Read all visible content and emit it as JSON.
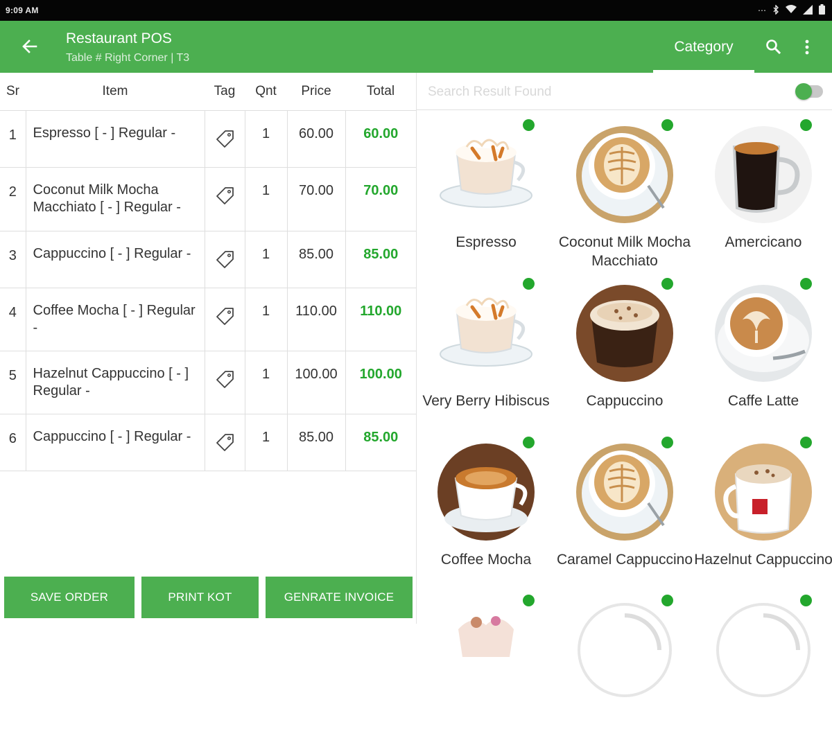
{
  "status": {
    "time": "9:09 AM"
  },
  "appbar": {
    "title": "Restaurant POS",
    "subtitle": "Table # Right Corner | T3",
    "tab_label": "Category"
  },
  "order": {
    "headers": {
      "sr": "Sr",
      "item": "Item",
      "tag": "Tag",
      "qnt": "Qnt",
      "price": "Price",
      "total": "Total"
    },
    "rows": [
      {
        "sr": "1",
        "item": "Espresso [ - ] Regular -",
        "qnt": "1",
        "price": "60.00",
        "total": "60.00"
      },
      {
        "sr": "2",
        "item": "Coconut Milk Mocha Macchiato [ - ] Regular -",
        "qnt": "1",
        "price": "70.00",
        "total": "70.00"
      },
      {
        "sr": "3",
        "item": "Cappuccino [ - ] Regular -",
        "qnt": "1",
        "price": "85.00",
        "total": "85.00"
      },
      {
        "sr": "4",
        "item": "Coffee Mocha [ - ] Regular -",
        "qnt": "1",
        "price": "110.00",
        "total": "110.00"
      },
      {
        "sr": "5",
        "item": "Hazelnut Cappuccino [ - ] Regular -",
        "qnt": "1",
        "price": "100.00",
        "total": "100.00"
      },
      {
        "sr": "6",
        "item": "Cappuccino [ - ] Regular -",
        "qnt": "1",
        "price": "85.00",
        "total": "85.00"
      }
    ]
  },
  "buttons": {
    "save": "SAVE ORDER",
    "print": "PRINT KOT",
    "invoice": "GENRATE INVOICE"
  },
  "search": {
    "placeholder": "Search Result Found"
  },
  "products": [
    {
      "name": "Espresso",
      "image": "latte-glass-cup-icon"
    },
    {
      "name": "Coconut Milk Mocha Macchiato",
      "image": "latte-art-cup-icon"
    },
    {
      "name": "Amercicano",
      "image": "black-coffee-mug-icon"
    },
    {
      "name": "Very Berry Hibiscus",
      "image": "latte-glass-cup-icon"
    },
    {
      "name": "Cappuccino",
      "image": "cappuccino-foam-cup-icon"
    },
    {
      "name": "Caffe Latte",
      "image": "latte-art-cup-icon"
    },
    {
      "name": "Coffee Mocha",
      "image": "coffee-cup-icon"
    },
    {
      "name": "Caramel Cappuccino",
      "image": "latte-art-cup-icon"
    },
    {
      "name": "Hazelnut Cappuccino",
      "image": "cappuccino-mug-icon"
    }
  ],
  "colors": {
    "primary": "#4caf50",
    "total_text": "#23a72d",
    "status_bar": "#050505"
  }
}
